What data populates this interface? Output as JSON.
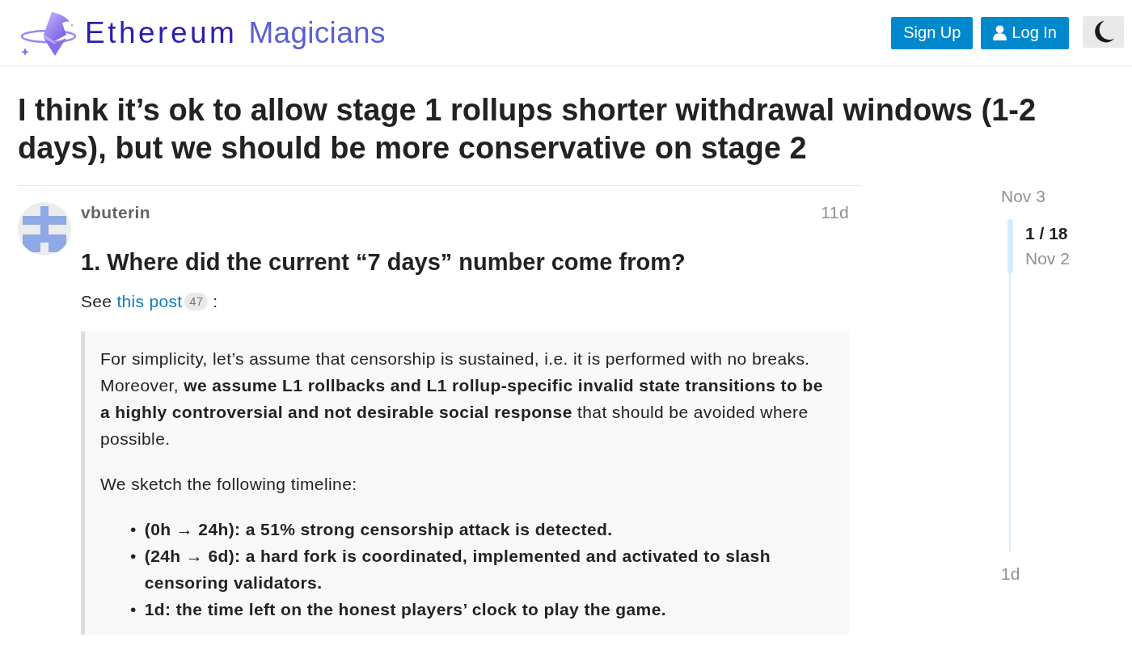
{
  "header": {
    "logo": {
      "words": [
        "Ethereum",
        "Magicians"
      ]
    },
    "buttons": [
      {
        "kind": "signup",
        "label": "Sign Up"
      },
      {
        "kind": "login",
        "label": "Log In"
      },
      {
        "kind": "theme"
      }
    ]
  },
  "topic": {
    "title": "I think it’s ok to allow stage 1 rollups shorter withdrawal windows (1-2 days), but we should be more conservative on stage 2"
  },
  "post": {
    "username": "vbuterin",
    "age": "11d",
    "heading": "1. Where did the current “7 days” number come from?",
    "intro": {
      "before": "See",
      "link": "this post",
      "clicks": "47",
      "after": ":"
    },
    "quote": {
      "paragraphs": [
        "For simplicity, let’s assume that censorship is sustained, i.e. it is performed with no breaks. Moreover, **we assume L1 rollbacks and L1 rollup-specific invalid state transitions to be a highly controversial and not desirable social response** that should be avoided where possible.",
        "We sketch the following timeline:"
      ],
      "list": [
        {
          "marker": "•",
          "text": "(0h → 24h): a 51% strong censorship attack is detected."
        },
        {
          "marker": "•",
          "text": "(24h → 6d): a hard fork is coordinated, implemented and activated to slash censoring validators."
        },
        {
          "marker": "•",
          "text": "1d: the time left on the honest players’ clock to play the game."
        }
      ]
    }
  },
  "timeline": {
    "start": "Nov 3",
    "position": "1 / 18",
    "position_date": "Nov 2",
    "end": "1d"
  }
}
